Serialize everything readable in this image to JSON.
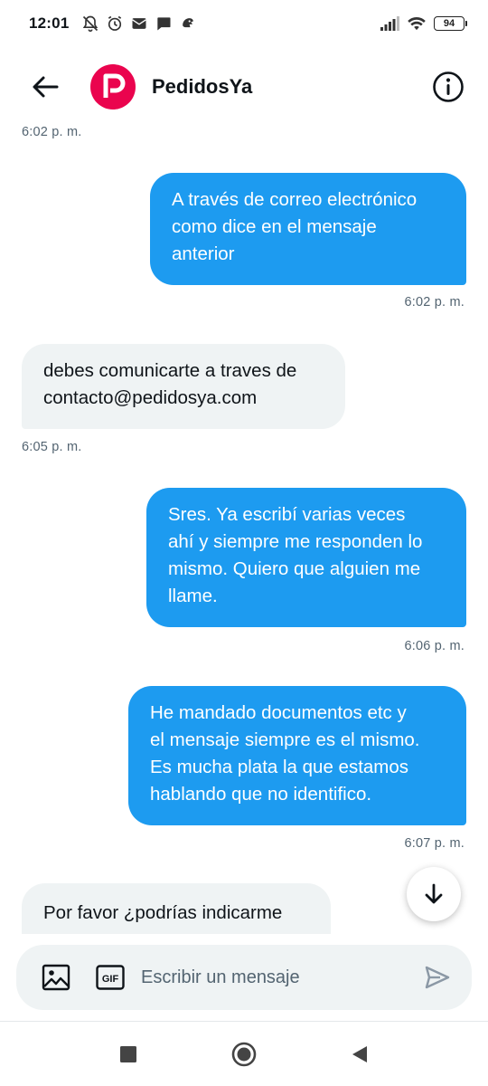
{
  "status_bar": {
    "time": "12:01",
    "battery": "94"
  },
  "header": {
    "title": "PedidosYa"
  },
  "messages": [
    {
      "kind": "timestamp",
      "side": "left",
      "time": "6:02 p. m."
    },
    {
      "kind": "bubble",
      "side": "out",
      "lines": [
        "A través de correo electrónico",
        "como dice en el mensaje",
        "anterior"
      ]
    },
    {
      "kind": "timestamp",
      "side": "right",
      "time": "6:02 p. m."
    },
    {
      "kind": "bubble",
      "side": "in",
      "lines": [
        "debes comunicarte a traves de",
        "contacto@pedidosya.com"
      ]
    },
    {
      "kind": "timestamp",
      "side": "left",
      "time": "6:05 p. m."
    },
    {
      "kind": "bubble",
      "side": "out",
      "lines": [
        "Sres. Ya escribí varias veces",
        "ahí y siempre me responden lo",
        "mismo. Quiero que alguien me",
        "llame."
      ]
    },
    {
      "kind": "timestamp",
      "side": "right",
      "time": "6:06 p. m."
    },
    {
      "kind": "bubble",
      "side": "out",
      "lines": [
        "He mandado documentos etc y",
        "el mensaje siempre es el mismo.",
        "Es mucha plata la que estamos",
        "hablando que no identifico."
      ]
    },
    {
      "kind": "timestamp",
      "side": "right",
      "time": "6:07 p. m."
    },
    {
      "kind": "bubble",
      "side": "in",
      "lines": [
        "Por favor ¿podrías indicarme"
      ]
    }
  ],
  "composer": {
    "placeholder": "Escribir un mensaje",
    "value": "",
    "gif_label": "GIF"
  },
  "colors": {
    "outgoing_bubble": "#1d9bf0",
    "incoming_bubble": "#eff3f4",
    "brand": "#ea044e"
  }
}
